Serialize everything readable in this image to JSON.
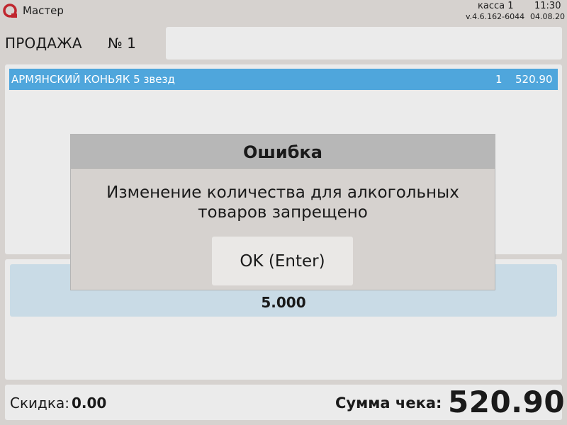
{
  "app": {
    "title": "Мастер"
  },
  "status": {
    "register": "касса 1",
    "time": "11:30",
    "version": "v.4.6.162-6044",
    "date": "04.08.20"
  },
  "sale": {
    "label": "ПРОДАЖА",
    "number": "№ 1"
  },
  "items": [
    {
      "name": "АРМЯНСКИЙ КОНЬЯК 5 звезд",
      "qty": "1",
      "price": "520.90"
    }
  ],
  "info": {
    "value": "5.000"
  },
  "footer": {
    "discount_label": "Скидка:",
    "discount_value": "0.00",
    "total_label": "Сумма чека:",
    "total_value": "520.90"
  },
  "dialog": {
    "title": "Ошибка",
    "message_line1": "Изменение количества для алкогольных",
    "message_line2": "товаров запрещено",
    "ok_label": "OK (Enter)"
  },
  "icons": {
    "logo": "app-logo-icon"
  },
  "colors": {
    "accent": "#4fa6dc",
    "logo": "#c0262e",
    "panel": "#ebebeb",
    "background": "#d6d2cf",
    "info_box": "#c9dbe6"
  }
}
